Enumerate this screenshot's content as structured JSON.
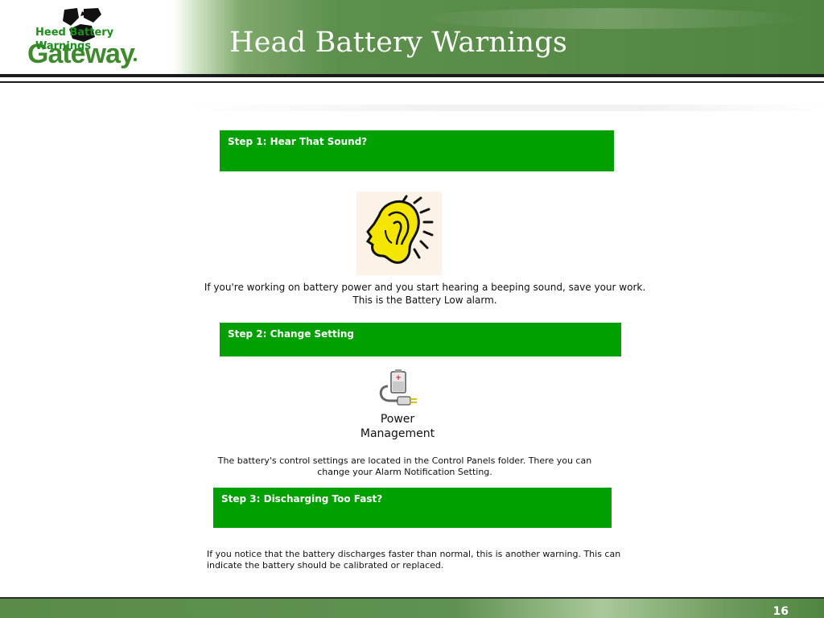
{
  "header": {
    "title": "Head Battery Warnings",
    "logo_text": "Gateway",
    "small_title": "Heed Battery Warnings"
  },
  "steps": [
    {
      "label": "Step 1: Hear That Sound?",
      "text": "If you're working on battery power and you start hearing a beeping sound, save your work. This is the Battery Low alarm."
    },
    {
      "label": "Step 2: Change Setting",
      "text": "The battery's control settings are located in the Control Panels folder. There you can change your Alarm Notification Setting."
    },
    {
      "label": "Step 3: Discharging Too Fast?",
      "text": "If you notice that the battery discharges faster than normal, this is another warning. This can indicate the battery should be calibrated or replaced."
    }
  ],
  "icon": {
    "name": "power-management-icon",
    "label_line1": "Power",
    "label_line2": "Management"
  },
  "footer": {
    "page_number": "16"
  },
  "colors": {
    "step_green": "#00a000",
    "header_green": "#5a8c49",
    "logo_green": "#3f8a2e"
  }
}
